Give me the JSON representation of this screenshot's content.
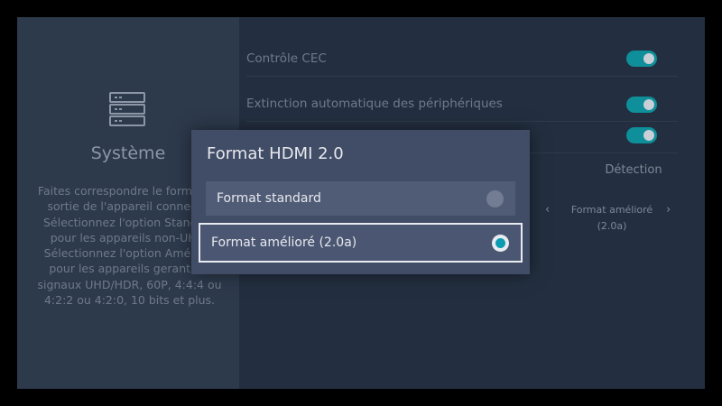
{
  "system": {
    "title": "Système",
    "description": "Faites correspondre le format de sortie de l'appareil connecté. Sélectionnez l'option Standard pour les appareils non-UHD. Sélectionnez l'option Amélioré pour les appareils gerant les signaux UHD/HDR, 60P, 4:4:4 ou 4:2:2 ou 4:2:0, 10 bits et plus.",
    "icon": "server-icon"
  },
  "settings": {
    "cec_label": "Contrôle CEC",
    "cec_on": true,
    "auto_off_label": "Extinction automatique des périphériques",
    "auto_off_on": true,
    "row3_on": true,
    "detect_label": "Détection",
    "hdmi_format_value": "Format amélioré (2.0a)"
  },
  "dialog": {
    "title": "Format HDMI 2.0",
    "options": [
      {
        "label": "Format standard",
        "selected": false
      },
      {
        "label": "Format amélioré (2.0a)",
        "selected": true
      }
    ]
  },
  "colors": {
    "accent": "#0d9bb0",
    "toggle_on": "#0e8f9a"
  }
}
